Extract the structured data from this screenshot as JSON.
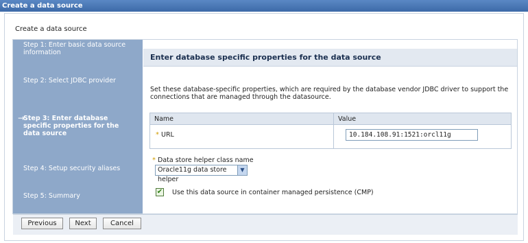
{
  "window": {
    "title": "Create a data source"
  },
  "page": {
    "heading": "Create a data source"
  },
  "steps": [
    {
      "label": "Step 1: Enter basic data source information",
      "current": false
    },
    {
      "label": "Step 2: Select JDBC provider",
      "current": false
    },
    {
      "label": "Step 3: Enter database specific properties for the data source",
      "current": true
    },
    {
      "label": "Step 4: Setup security aliases",
      "current": false
    },
    {
      "label": "Step 5: Summary",
      "current": false
    }
  ],
  "current_step_marker": "→",
  "content": {
    "title": "Enter database specific properties for the data source",
    "description": "Set these database-specific properties, which are required by the database vendor JDBC driver to support the connections that are managed through the datasource."
  },
  "table": {
    "headers": {
      "name": "Name",
      "value": "Value"
    },
    "rows": [
      {
        "required_mark": "*",
        "name": "URL",
        "value": "10.184.108.91:1521:orcl11g"
      }
    ]
  },
  "helper": {
    "required_mark": "*",
    "label": "Data store helper class name",
    "selected": "Oracle11g data store helper",
    "dropdown_glyph": "▼"
  },
  "cmp": {
    "checked": true,
    "check_glyph": "✔",
    "label": "Use this data source in container managed persistence (CMP)"
  },
  "buttons": {
    "previous": "Previous",
    "next": "Next",
    "cancel": "Cancel"
  },
  "colors": {
    "titlebar": "#4a78b8",
    "steps_panel": "#8ea8c9",
    "content_header": "#e3e9f1",
    "required": "#d19c00"
  }
}
